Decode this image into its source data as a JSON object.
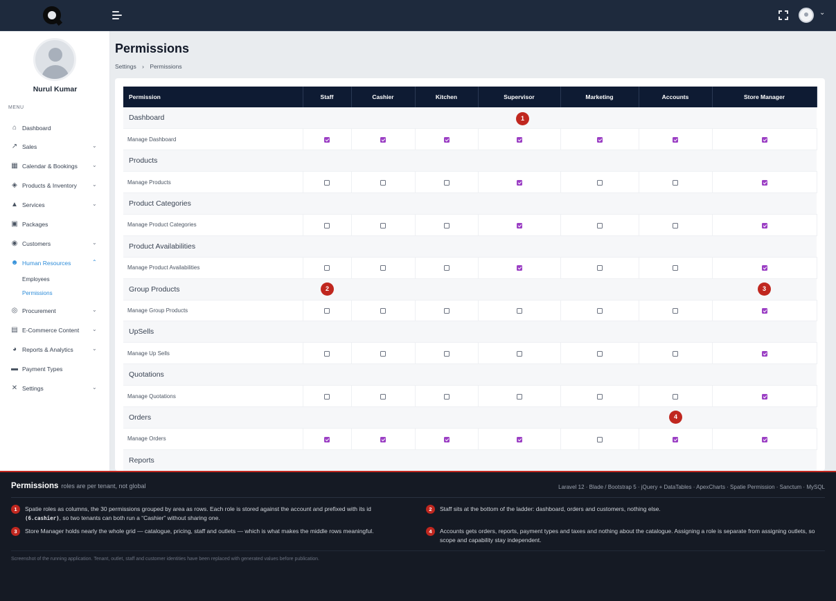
{
  "app": {
    "user_name": "Nurul Kumar",
    "menu_label": "MENU"
  },
  "sidebar": {
    "items": [
      {
        "label": "Dashboard",
        "icon": "home-icon",
        "glyph": "⌂",
        "chevron": false
      },
      {
        "label": "Sales",
        "icon": "chart-line-icon",
        "glyph": "↗",
        "chevron": true
      },
      {
        "label": "Calendar & Bookings",
        "icon": "calendar-icon",
        "glyph": "▦",
        "chevron": true
      },
      {
        "label": "Products & Inventory",
        "icon": "box-icon",
        "glyph": "◈",
        "chevron": true
      },
      {
        "label": "Services",
        "icon": "bell-service-icon",
        "glyph": "▲",
        "chevron": true
      },
      {
        "label": "Packages",
        "icon": "boxes-icon",
        "glyph": "▣",
        "chevron": false
      },
      {
        "label": "Customers",
        "icon": "user-circle-icon",
        "glyph": "◉",
        "chevron": true
      },
      {
        "label": "Human Resources",
        "icon": "users-icon",
        "glyph": "☻",
        "chevron": true,
        "active": true
      },
      {
        "label": "Procurement",
        "icon": "coins-icon",
        "glyph": "◎",
        "chevron": true
      },
      {
        "label": "E-Commerce Content",
        "icon": "window-icon",
        "glyph": "▤",
        "chevron": true
      },
      {
        "label": "Reports & Analytics",
        "icon": "pie-chart-icon",
        "glyph": "◕",
        "chevron": true
      },
      {
        "label": "Payment Types",
        "icon": "credit-card-icon",
        "glyph": "▬",
        "chevron": false
      },
      {
        "label": "Settings",
        "icon": "tools-icon",
        "glyph": "✕",
        "chevron": true
      }
    ],
    "sub_items": [
      {
        "label": "Employees",
        "current": false
      },
      {
        "label": "Permissions",
        "current": true
      }
    ]
  },
  "page": {
    "title": "Permissions",
    "breadcrumb": [
      "Settings",
      "Permissions"
    ],
    "breadcrumb_separator": "›"
  },
  "table": {
    "headers": [
      "Permission",
      "Staff",
      "Cashier",
      "Kitchen",
      "Supervisor",
      "Marketing",
      "Accounts",
      "Store Manager"
    ],
    "groups": [
      {
        "name": "Dashboard",
        "permission": "Manage Dashboard",
        "checks": [
          true,
          true,
          true,
          true,
          true,
          true,
          true
        ]
      },
      {
        "name": "Products",
        "permission": "Manage Products",
        "checks": [
          false,
          false,
          false,
          true,
          false,
          false,
          true
        ]
      },
      {
        "name": "Product Categories",
        "permission": "Manage Product Categories",
        "checks": [
          false,
          false,
          false,
          true,
          false,
          false,
          true
        ]
      },
      {
        "name": "Product Availabilities",
        "permission": "Manage Product Availabilities",
        "checks": [
          false,
          false,
          false,
          true,
          false,
          false,
          true
        ]
      },
      {
        "name": "Group Products",
        "permission": "Manage Group Products",
        "checks": [
          false,
          false,
          false,
          false,
          false,
          false,
          true
        ]
      },
      {
        "name": "UpSells",
        "permission": "Manage Up Sells",
        "checks": [
          false,
          false,
          false,
          false,
          false,
          false,
          true
        ]
      },
      {
        "name": "Quotations",
        "permission": "Manage Quotations",
        "checks": [
          false,
          false,
          false,
          false,
          false,
          false,
          true
        ]
      },
      {
        "name": "Orders",
        "permission": "Manage Orders",
        "checks": [
          true,
          true,
          true,
          true,
          false,
          true,
          true
        ]
      },
      {
        "name": "Reports",
        "permission": null,
        "checks": []
      }
    ]
  },
  "markers": [
    "1",
    "2",
    "3",
    "4"
  ],
  "footer": {
    "title": "Permissions",
    "subtitle": "roles are per tenant, not global",
    "tech": "Laravel 12 · Blade / Bootstrap 5 · jQuery + DataTables · ApexCharts · Spatie Permission · Sanctum · MySQL",
    "notes": [
      {
        "num": "1",
        "text_a": "Spatie roles as columns, the 30 permissions grouped by area as rows. Each role is stored against the account and prefixed with its id",
        "code": "(6.cashier)",
        "text_b": ", so two tenants can both run a “Cashier” without sharing one."
      },
      {
        "num": "2",
        "text": "Staff sits at the bottom of the ladder: dashboard, orders and customers, nothing else."
      },
      {
        "num": "3",
        "text": "Store Manager holds nearly the whole grid — catalogue, pricing, staff and outlets — which is what makes the middle rows meaningful."
      },
      {
        "num": "4",
        "text": "Accounts gets orders, reports, payment types and taxes and nothing about the catalogue. Assigning a role is separate from assigning outlets, so scope and capability stay independent."
      }
    ],
    "disclaimer": "Screenshot of the running application. Tenant, outlet, staff and customer identities have been replaced with generated values before publication."
  },
  "colors": {
    "accent": "#2b8bd8",
    "checkbox": "#9b3fc4",
    "marker": "#c0271f",
    "header_bg": "#0e1b33",
    "topbar_bg": "#1e2a3d"
  }
}
